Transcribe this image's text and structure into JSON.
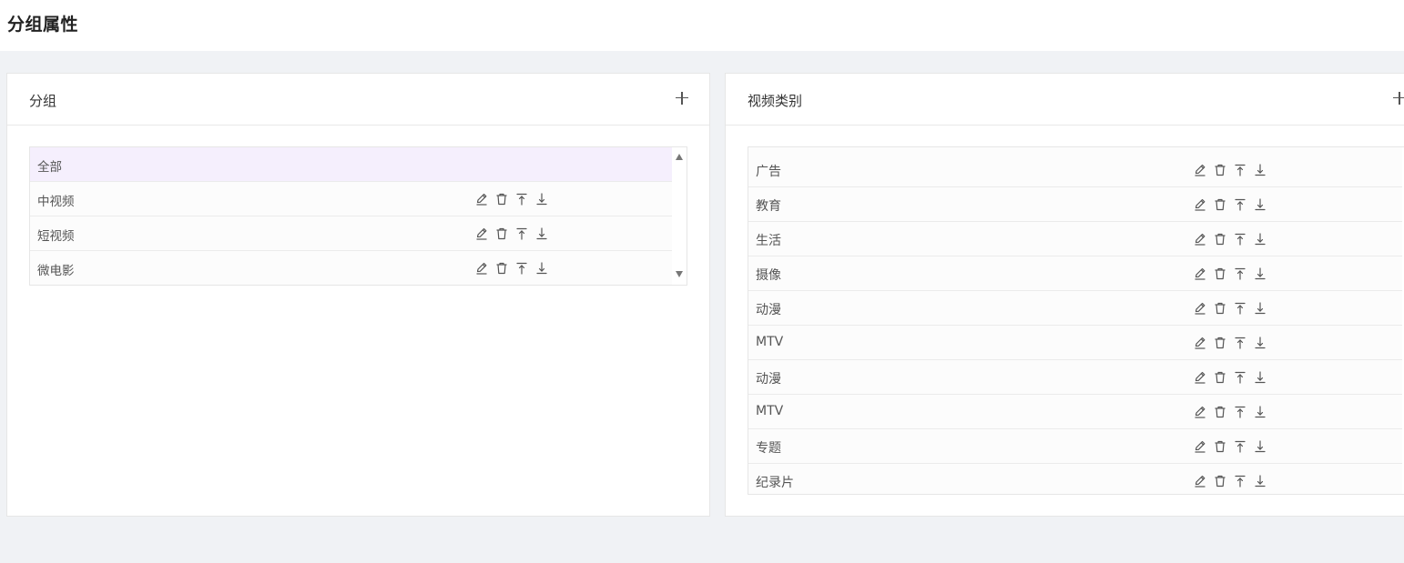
{
  "page": {
    "title": "分组属性"
  },
  "groups_panel": {
    "title": "分组",
    "add_icon": "plus-icon",
    "items": [
      {
        "label": "全部",
        "selected": true,
        "has_actions": false
      },
      {
        "label": "中视频",
        "selected": false,
        "has_actions": true
      },
      {
        "label": "短视频",
        "selected": false,
        "has_actions": true
      },
      {
        "label": "微电影",
        "selected": false,
        "has_actions": true
      }
    ]
  },
  "category_panel": {
    "title": "视频类别",
    "add_icon": "plus-icon",
    "items": [
      {
        "label": "广告"
      },
      {
        "label": "教育"
      },
      {
        "label": "生活"
      },
      {
        "label": "摄像"
      },
      {
        "label": "动漫"
      },
      {
        "label": "MTV"
      },
      {
        "label": "动漫"
      },
      {
        "label": "MTV"
      },
      {
        "label": "专题"
      },
      {
        "label": "纪录片"
      }
    ]
  },
  "row_actions": [
    "edit-icon",
    "delete-icon",
    "move-top-icon",
    "move-bottom-icon"
  ],
  "colors": {
    "selected_row": "#f5effd",
    "background": "#f0f2f5",
    "icon": "#555555"
  }
}
